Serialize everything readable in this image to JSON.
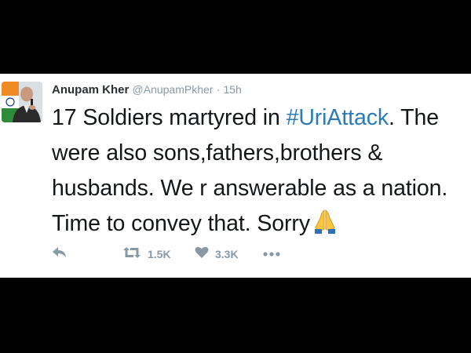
{
  "tweet": {
    "author_name": "Anupam Kher",
    "author_handle": "@AnupamPkher",
    "separator": "·",
    "timestamp": "15h",
    "text_before": "17 Soldiers martyred in ",
    "hashtag": "#UriAttack",
    "text_after": ". The were also sons,fathers,brothers & husbands. We r answerable as a nation. Time to convey that. Sorry",
    "emoji": "folded-hands-emoji",
    "hashtag_color": "#2b7bb9"
  },
  "actions": {
    "reply_icon": "reply-icon",
    "retweet_icon": "retweet-icon",
    "retweet_count": "1.5K",
    "like_icon": "heart-icon",
    "like_count": "3.3K",
    "more_icon": "more-icon"
  }
}
